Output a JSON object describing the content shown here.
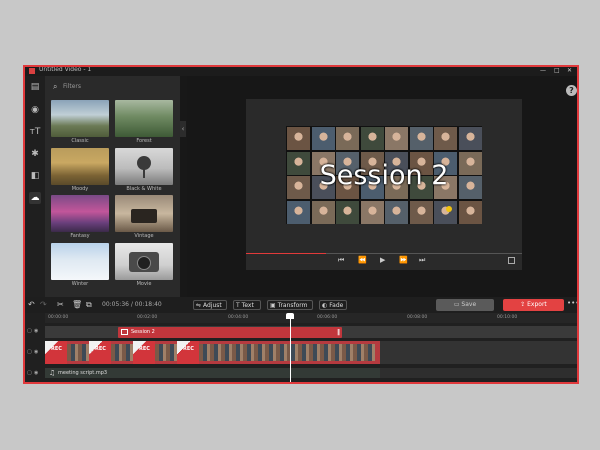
{
  "window": {
    "title": "Untitled Video - 1",
    "close": "✕",
    "maximize": "□",
    "minimize": "—"
  },
  "sidebar": {
    "icons": [
      "media-icon",
      "template-icon",
      "text-icon",
      "effects-icon",
      "transition-icon",
      "filter-icon"
    ]
  },
  "filters": {
    "search_placeholder": "Filters",
    "items": [
      {
        "label": "Classic"
      },
      {
        "label": "Forest"
      },
      {
        "label": "Moody"
      },
      {
        "label": "Black & White"
      },
      {
        "label": "Fantasy"
      },
      {
        "label": "Vintage"
      },
      {
        "label": "Winter"
      },
      {
        "label": "Movie"
      }
    ]
  },
  "preview": {
    "overlay_text": "Session 2",
    "progress": 0.29
  },
  "player_controls": {
    "prev": "⏮",
    "rewind": "⏪",
    "play": "▶",
    "forward": "⏩",
    "next": "⏭"
  },
  "toolbar": {
    "time": "00:05:36 / 00:18:40",
    "adjust": "Adjust",
    "text": "Text",
    "transform": "Transform",
    "fade": "Fade",
    "save": "Save",
    "export": "Export",
    "more": "•••"
  },
  "timeline": {
    "ticks": [
      "00:00:00",
      "00:02:00",
      "00:04:00",
      "00:06:00",
      "00:08:00",
      "00:10:00"
    ],
    "text_clip_label": "Session 2",
    "audio_label": "meeting script.mp3",
    "rec_label": "REC"
  },
  "colors": {
    "accent": "#e34242",
    "frame_border": "#e0393c",
    "clip_red": "#c1363c"
  }
}
